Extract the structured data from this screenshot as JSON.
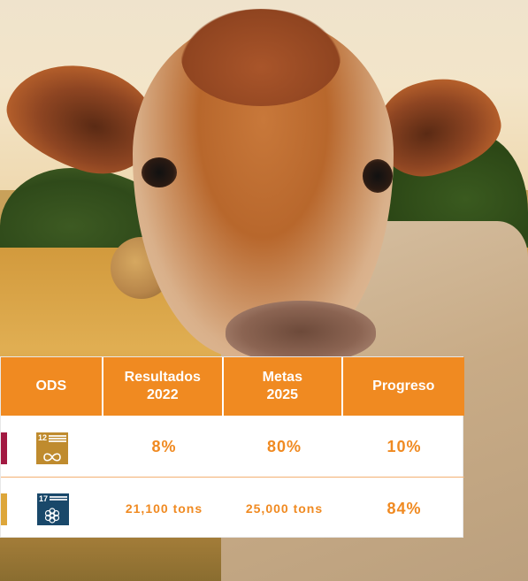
{
  "table": {
    "headers": {
      "ods": "ODS",
      "resultados_line1": "Resultados",
      "resultados_line2": "2022",
      "metas_line1": "Metas",
      "metas_line2": "2025",
      "progreso": "Progreso"
    },
    "rows": [
      {
        "sdg_icons": [
          "sdg-12-responsible-consumption-icon"
        ],
        "sdg_number": "12",
        "resultados": "8%",
        "metas": "80%",
        "progreso": "10%"
      },
      {
        "sdg_icons": [
          "sdg-17-partnerships-icon"
        ],
        "sdg_number": "17",
        "resultados": "21,100 tons",
        "metas": "25,000 tons",
        "progreso": "84%"
      }
    ]
  },
  "colors": {
    "header_bg": "#f08a21",
    "value_text": "#f08a21",
    "sdg12": "#bf8b2e",
    "sdg17": "#19486a"
  }
}
